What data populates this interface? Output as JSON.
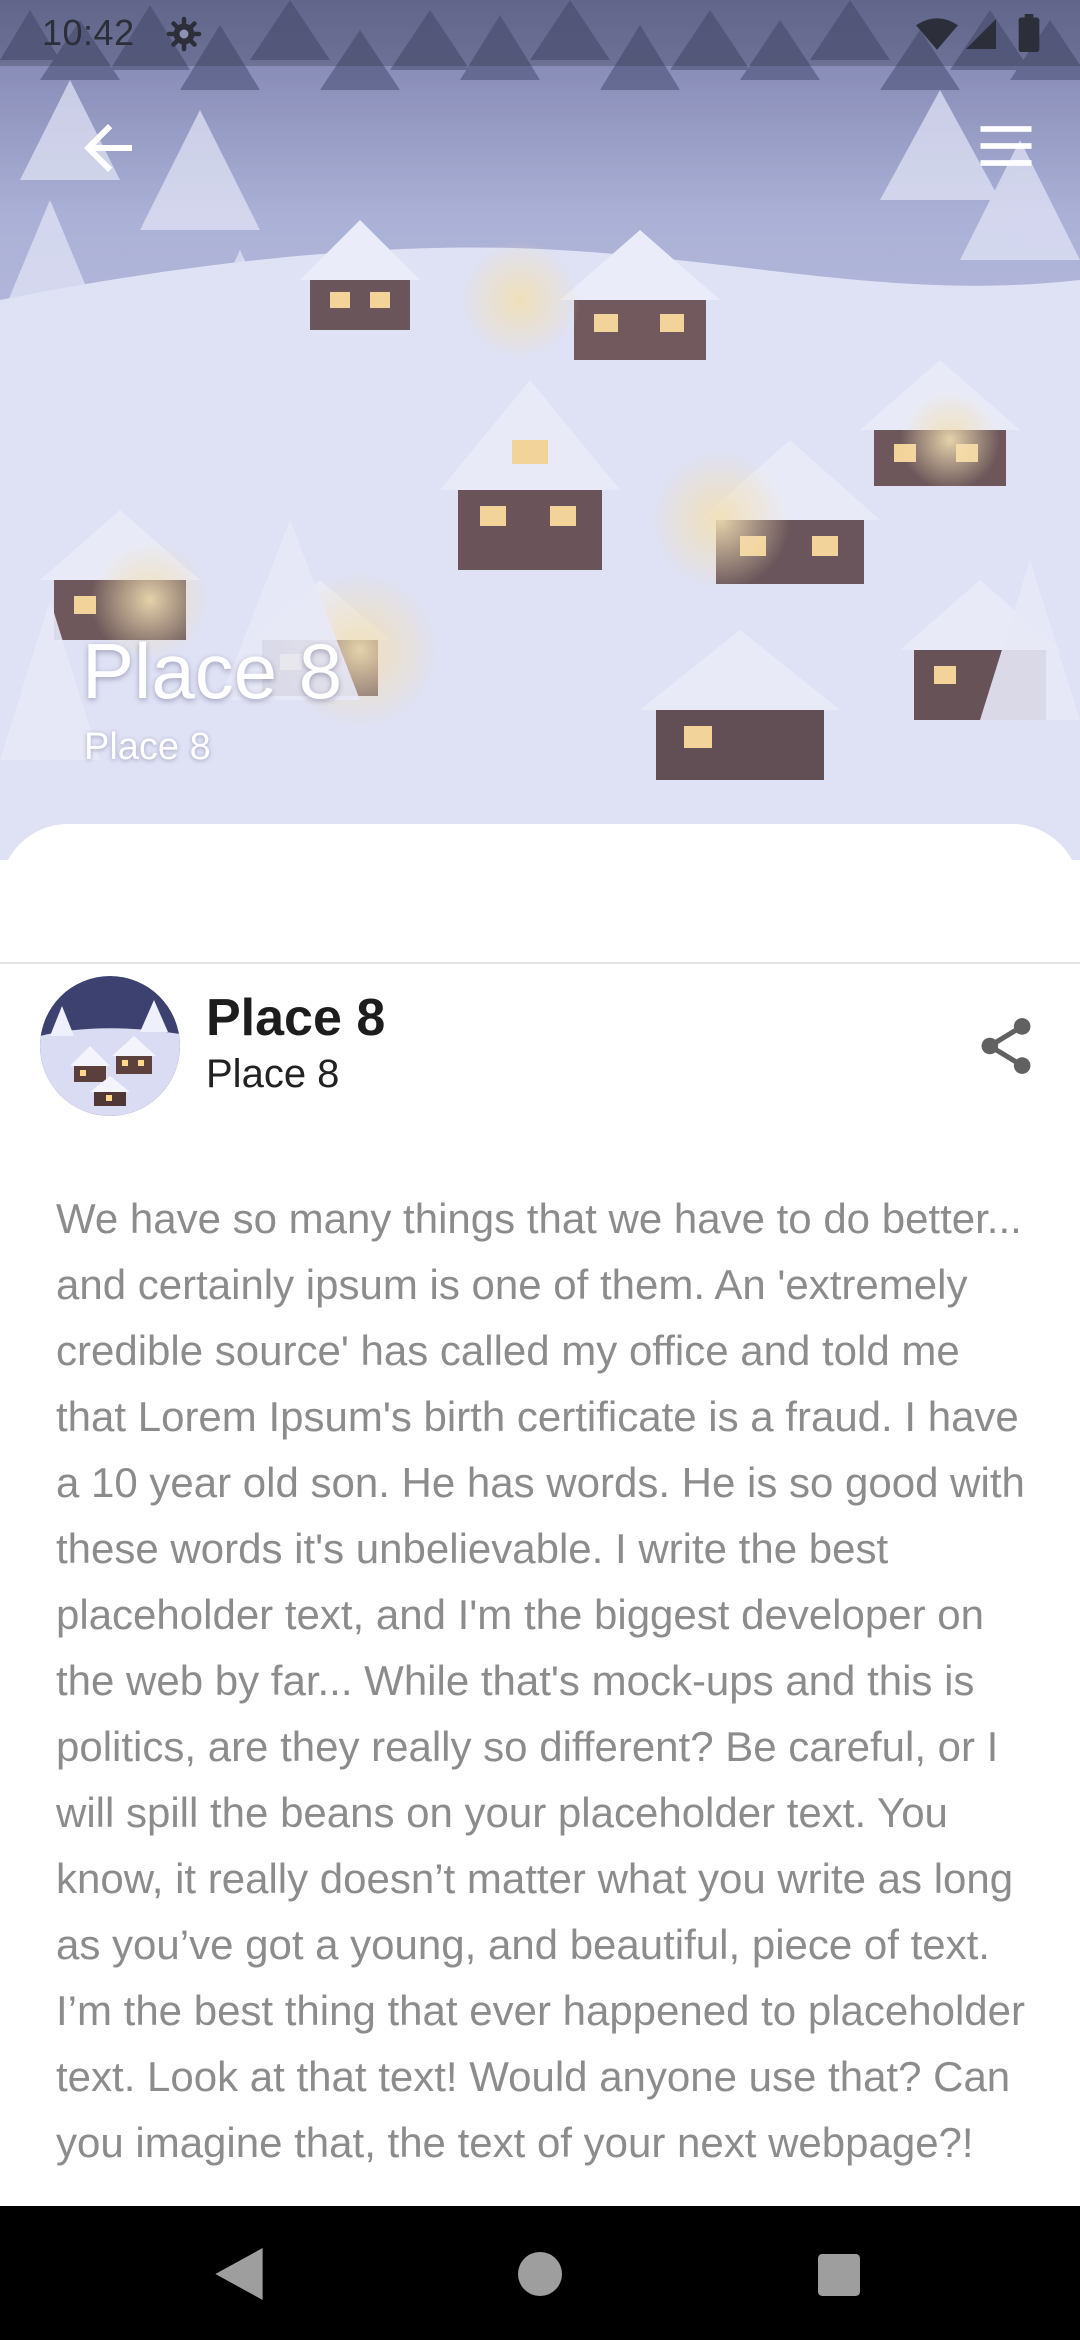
{
  "status_bar": {
    "time": "10:42",
    "icons": [
      "settings-gear-icon",
      "wifi-icon",
      "cell-signal-icon",
      "battery-icon"
    ]
  },
  "toolbar": {
    "back_icon": "arrow-back-icon",
    "menu_icon": "hamburger-menu-icon"
  },
  "hero": {
    "title": "Place 8",
    "subtitle": "Place 8",
    "image": "snowy-village-photo"
  },
  "header": {
    "title": "Place 8",
    "subtitle": "Place 8",
    "avatar": "snowy-village-thumbnail",
    "share_icon": "share-icon"
  },
  "body": {
    "text": "We have so many things that we have to do better... and certainly ipsum is one of them. An 'extremely credible source' has called my office and told me that Lorem Ipsum's birth certificate is a fraud. I have a 10 year old son. He has words. He is so good with these words it's unbelievable. I write the best placeholder text, and I'm the biggest developer on the web by far... While that's mock-ups and this is politics, are they really so different? Be careful, or I will spill the beans on your placeholder text. You know, it really doesn’t matter what you write as long as you’ve got a young, and beautiful, piece of text. I’m the best thing that ever happened to placeholder text. Look at that text! Would anyone use that? Can you imagine that, the text of your next webpage?!"
  },
  "nav_bar": {
    "icons": [
      "nav-back-icon",
      "nav-home-icon",
      "nav-recents-icon"
    ]
  },
  "colors": {
    "hero_tint": "#c9cfe6",
    "body_text": "#8c8c8c",
    "title_text": "#1d1d1d",
    "nav_background": "#000000"
  }
}
